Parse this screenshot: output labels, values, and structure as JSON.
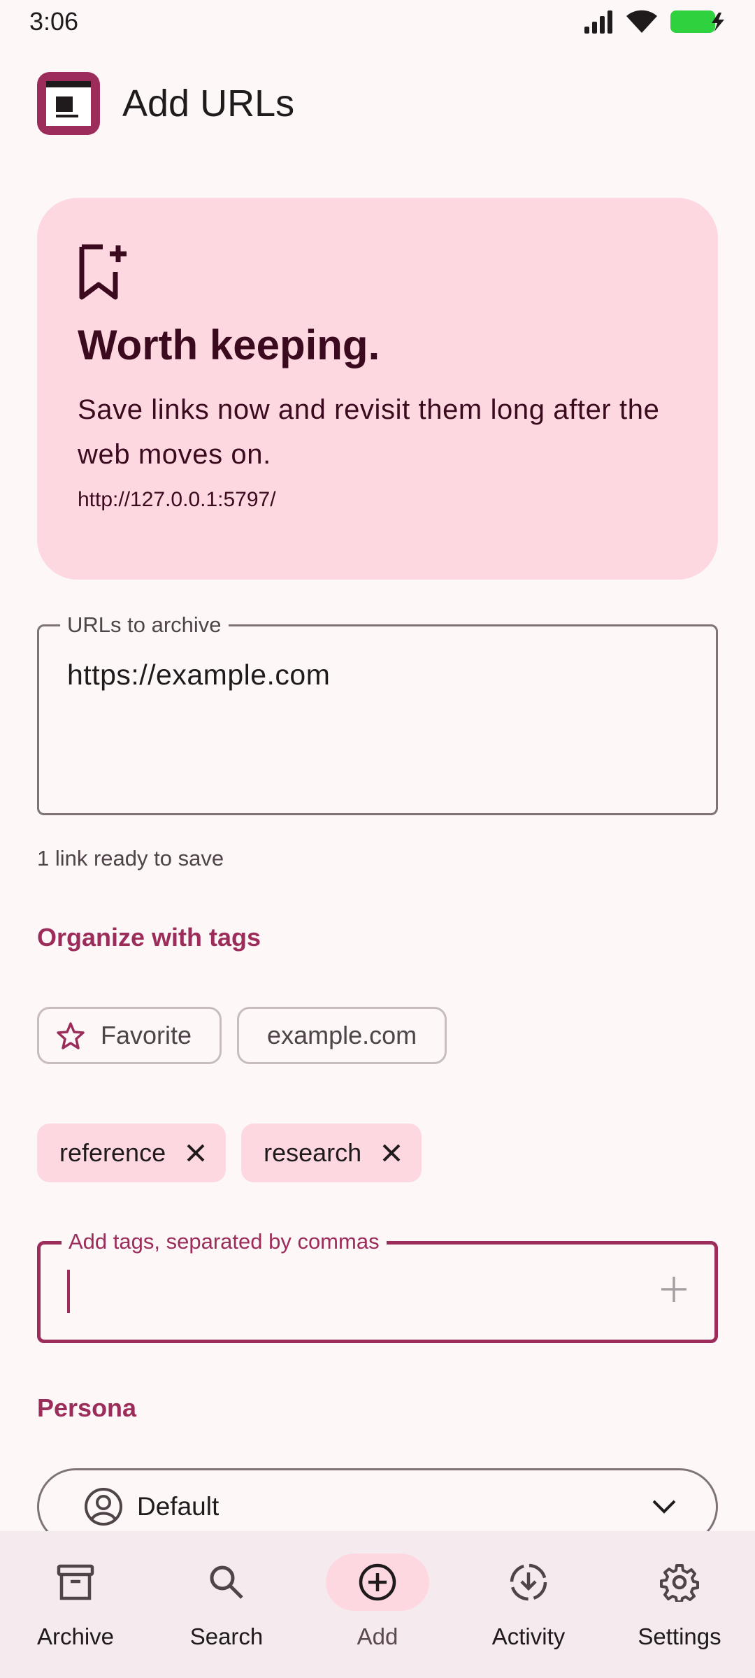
{
  "status_bar": {
    "time": "3:06"
  },
  "app_bar": {
    "title": "Add URLs"
  },
  "hero": {
    "icon": "bookmark-add-icon",
    "title": "Worth keeping.",
    "body": "Save links now and revisit them long after the web moves on.",
    "server_url": "http://127.0.0.1:5797/"
  },
  "urls_field": {
    "label": "URLs to archive",
    "value": "https://example.com",
    "helper": "1 link ready to save"
  },
  "tags_section": {
    "title": "Organize with tags",
    "suggestions": [
      {
        "label": "Favorite",
        "icon": "star-icon"
      },
      {
        "label": "example.com"
      }
    ],
    "selected": [
      {
        "label": "reference"
      },
      {
        "label": "research"
      }
    ],
    "input_label": "Add tags, separated by commas",
    "input_value": ""
  },
  "persona_section": {
    "title": "Persona",
    "selected": "Default"
  },
  "bottom_nav": {
    "items": [
      {
        "label": "Archive",
        "icon": "archive-icon"
      },
      {
        "label": "Search",
        "icon": "search-icon"
      },
      {
        "label": "Add",
        "icon": "add-circle-icon",
        "active": true
      },
      {
        "label": "Activity",
        "icon": "download-progress-icon"
      },
      {
        "label": "Settings",
        "icon": "gear-icon"
      }
    ]
  },
  "colors": {
    "primary": "#9c2d5a",
    "primary_container": "#fdd8e1",
    "background": "#fdf7f8",
    "battery": "#2fd13f"
  }
}
